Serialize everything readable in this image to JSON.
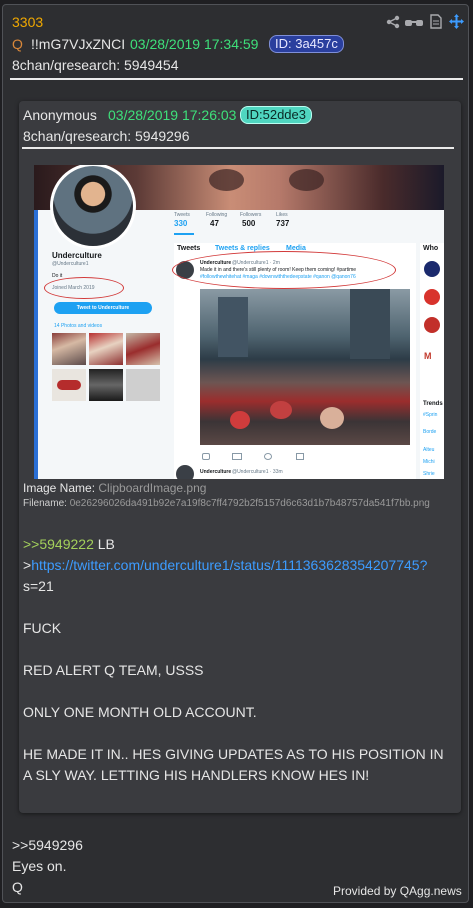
{
  "post": {
    "number": "3303",
    "qmark": "Q",
    "tripcode": "!!mG7VJxZNCI",
    "date": "03/28/2019 17:34:59",
    "id": "ID: 3a457c",
    "source_prefix": "8chan/qresearch:",
    "source_num": "5949454"
  },
  "quoted": {
    "name": "Anonymous",
    "date": "03/28/2019 17:26:03",
    "id": "ID:52dde3",
    "source_prefix": "8chan/qresearch:",
    "source_num": "5949296",
    "image_name_label": "Image Name:",
    "image_name": "ClipboardImage.png",
    "filename_label": "Filename:",
    "filename": "0e26296026da491b92e7a19f8c7ff4792b2f5157d6c63d1b7b48757da541f7bb.png",
    "ref_link": ">>5949222",
    "ref_suffix": " LB",
    "url_prefix": ">",
    "url_line1": "https://twitter.com/underculture1/status/1111363628354207745?",
    "url_line2": "s=21",
    "lines": [
      "FUCK",
      "RED ALERT Q TEAM, USSS",
      "ONLY ONE MONTH OLD ACCOUNT.",
      "HE MADE IT IN.. HES GIVING UPDATES AS TO HIS POSITION IN",
      "A SLY WAY. LETTING HIS HANDLERS KNOW HES IN!"
    ]
  },
  "screenshot": {
    "stats": [
      {
        "label": "Tweets",
        "value": "330"
      },
      {
        "label": "Following",
        "value": "47"
      },
      {
        "label": "Followers",
        "value": "500"
      },
      {
        "label": "Likes",
        "value": "737"
      }
    ],
    "profile_name": "Underculture",
    "profile_handle": "@Underculture1",
    "profile_loc": "Do it",
    "joined": "Joined March 2019",
    "tweet_to": "Tweet to Underculture",
    "photos": "14 Photos and videos",
    "tabs": [
      "Tweets",
      "Tweets & replies",
      "Media"
    ],
    "tweet_name": "Underculture",
    "tweet_handle": "@Underculture1 · 2m",
    "tweet_text1": "Made it in and there's still plenty of room! Keep them coming! #partime",
    "tweet_text2": "#followthewhitehat #maga #downwiththedeepstate #qanon @qanon76",
    "tweet2_name": "Underculture",
    "tweet2_handle": "@Underculture1 · 33m",
    "right_title": "Who",
    "trends": "Trends",
    "trend_items": [
      "#Sprin",
      "Borde",
      "Alteu",
      "Michi",
      "Shrie"
    ]
  },
  "reply": {
    "ref": ">>5949296",
    "line1": "Eyes on.",
    "line2": "Q"
  },
  "footer": "Provided by QAgg.news",
  "colors": {
    "number": "#f0a800",
    "date": "#3ee07a",
    "link": "#3d9cff",
    "greentext": "#a4d15b"
  }
}
